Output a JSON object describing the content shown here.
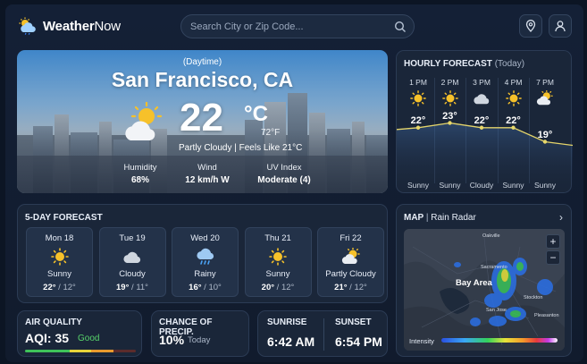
{
  "header": {
    "logo_weather": "Weather",
    "logo_now": "Now",
    "search_placeholder": "Search City or Zip Code..."
  },
  "current": {
    "period": "(Daytime)",
    "city": "San Francisco, CA",
    "temp_c": "22",
    "unit": "°C",
    "temp_f": "72°F",
    "conditions": "Partly Cloudy | Feels Like 21°C",
    "icon": "partly-cloudy-icon",
    "humidity_label": "Humidity",
    "humidity_value": "68%",
    "wind_label": "Wind",
    "wind_value": "12 km/h W",
    "uv_label": "UV Index",
    "uv_value": "Moderate (4)"
  },
  "hourly": {
    "title": "HOURLY FORECAST",
    "subtitle": "(Today)",
    "hours": [
      {
        "time": "1 PM",
        "icon": "sun-icon",
        "temp": "22°",
        "summary": "Sunny",
        "value": 22
      },
      {
        "time": "2 PM",
        "icon": "sun-icon",
        "temp": "23°",
        "summary": "Sunny",
        "value": 23
      },
      {
        "time": "3 PM",
        "icon": "cloud-icon",
        "temp": "22°",
        "summary": "Cloudy",
        "value": 22
      },
      {
        "time": "4 PM",
        "icon": "sun-icon",
        "temp": "22°",
        "summary": "Sunny",
        "value": 22
      },
      {
        "time": "7 PM",
        "icon": "partly-cloudy-icon",
        "temp": "19°",
        "summary": "Sunny",
        "value": 19
      }
    ]
  },
  "forecast": {
    "title": "5-DAY FORECAST",
    "days": [
      {
        "day": "Mon 18",
        "icon": "sun-icon",
        "cond": "Sunny",
        "hi": "22°",
        "lo": "12°"
      },
      {
        "day": "Tue 19",
        "icon": "cloud-icon",
        "cond": "Cloudy",
        "hi": "19°",
        "lo": "11°"
      },
      {
        "day": "Wed 20",
        "icon": "rain-icon",
        "cond": "Rainy",
        "hi": "16°",
        "lo": "10°"
      },
      {
        "day": "Thu 21",
        "icon": "sun-icon",
        "cond": "Sunny",
        "hi": "20°",
        "lo": "12°"
      },
      {
        "day": "Fri 22",
        "icon": "partly-cloudy-icon",
        "cond": "Partly Cloudy",
        "hi": "21°",
        "lo": "12°"
      }
    ]
  },
  "air_quality": {
    "title": "AIR QUALITY",
    "value": "AQI: 35",
    "status": "Good"
  },
  "precip": {
    "title": "CHANCE OF PRECIP.",
    "value": "10%",
    "period": "Today"
  },
  "sun": {
    "sunrise_label": "SUNRISE",
    "sunrise": "6:42 AM",
    "sunset_label": "SUNSET",
    "sunset": "6:54 PM"
  },
  "map": {
    "title": "MAP",
    "divider": "|",
    "subtitle": "Rain Radar",
    "labels": {
      "area": "Bay Area",
      "l1": "Oakville",
      "l2": "Sacramento",
      "l3": "Stockton",
      "l4": "Pleasanton",
      "l5": "San Jose"
    },
    "intensity": "Intensity"
  },
  "colors": {
    "accent_blue": "#5b9bd5",
    "good_green": "#57d36a",
    "sun_yellow": "#f6c12a"
  }
}
